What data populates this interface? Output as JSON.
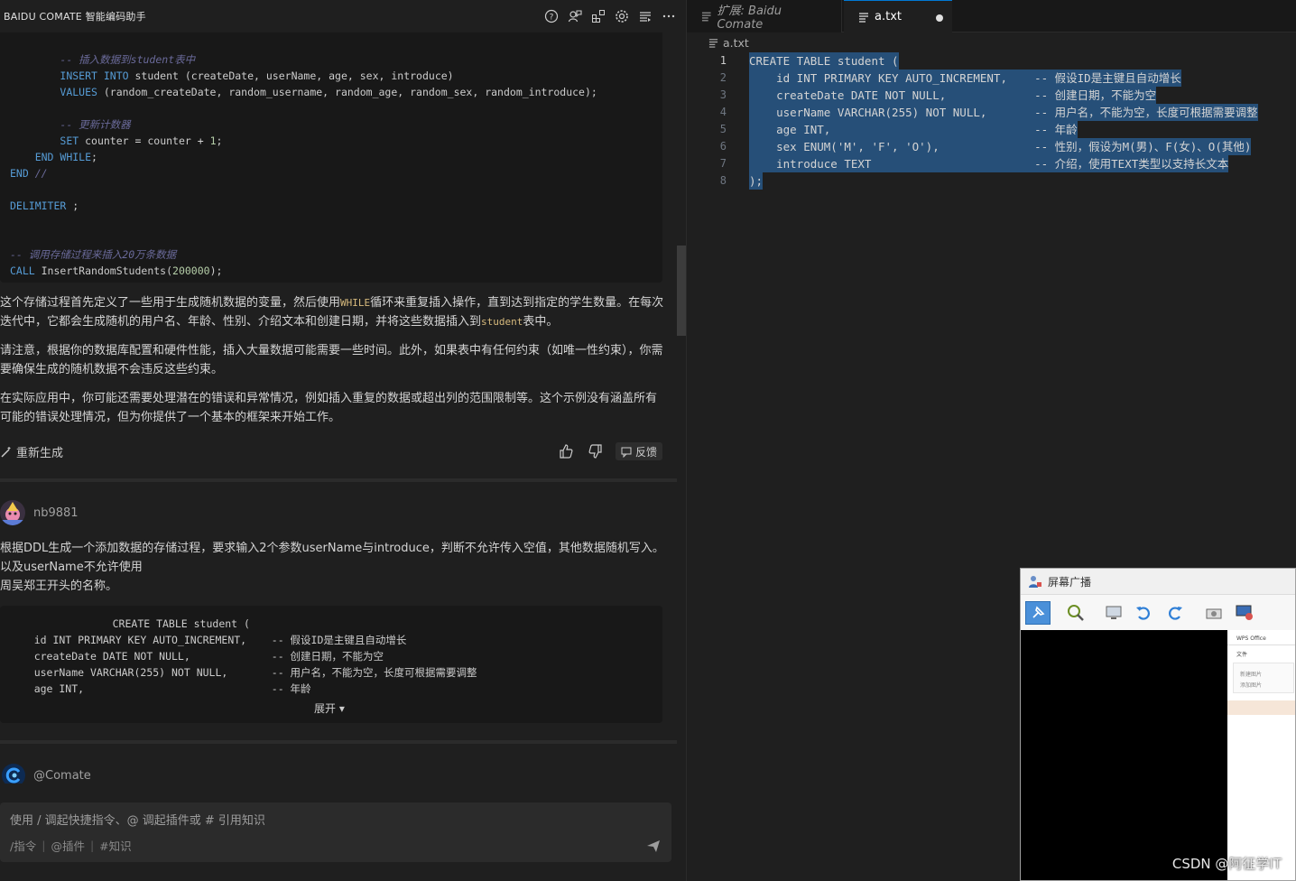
{
  "left_panel": {
    "title": "BAIDU COMATE 智能编码助手",
    "header_icons": [
      "help-icon",
      "user-chat-icon",
      "plugins-icon",
      "settings-icon",
      "list-icon",
      "more-icon"
    ],
    "code_block_1": {
      "lines": [
        {
          "indent": "        ",
          "parts": [
            {
              "t": "-- 插入数据到student表中",
              "c": "cmt2"
            }
          ]
        },
        {
          "indent": "        ",
          "parts": [
            {
              "t": "INSERT INTO",
              "c": "kw"
            },
            {
              "t": " student (createDate, userName, age, sex, introduce)",
              "c": ""
            }
          ]
        },
        {
          "indent": "        ",
          "parts": [
            {
              "t": "VALUES",
              "c": "kw"
            },
            {
              "t": " (random_createDate, random_username, random_age, random_sex, random_introduce);",
              "c": ""
            }
          ]
        },
        {
          "indent": "",
          "parts": []
        },
        {
          "indent": "        ",
          "parts": [
            {
              "t": "-- 更新计数器",
              "c": "cmt2"
            }
          ]
        },
        {
          "indent": "        ",
          "parts": [
            {
              "t": "SET",
              "c": "kw"
            },
            {
              "t": " counter ",
              "c": ""
            },
            {
              "t": "=",
              "c": "op"
            },
            {
              "t": " counter ",
              "c": ""
            },
            {
              "t": "+",
              "c": "op"
            },
            {
              "t": " ",
              "c": ""
            },
            {
              "t": "1",
              "c": "num"
            },
            {
              "t": ";",
              "c": ""
            }
          ]
        },
        {
          "indent": "    ",
          "parts": [
            {
              "t": "END WHILE",
              "c": "kw"
            },
            {
              "t": ";",
              "c": ""
            }
          ]
        },
        {
          "indent": "",
          "parts": [
            {
              "t": "END",
              "c": "kw"
            },
            {
              "t": " //",
              "c": "cmt2"
            }
          ]
        },
        {
          "indent": "",
          "parts": []
        },
        {
          "indent": "",
          "parts": [
            {
              "t": "DELIMITER",
              "c": "kw"
            },
            {
              "t": " ;",
              "c": ""
            }
          ]
        },
        {
          "indent": "",
          "parts": []
        },
        {
          "indent": "",
          "parts": []
        },
        {
          "indent": "",
          "parts": [
            {
              "t": "-- 调用存储过程来插入20万条数据",
              "c": "cmt2"
            }
          ]
        },
        {
          "indent": "",
          "parts": [
            {
              "t": "CALL",
              "c": "kw"
            },
            {
              "t": " InsertRandomStudents(",
              "c": ""
            },
            {
              "t": "200000",
              "c": "num"
            },
            {
              "t": ");",
              "c": ""
            }
          ]
        }
      ]
    },
    "paragraph_1": {
      "before": "这个存储过程首先定义了一些用于生成随机数据的变量，然后使用",
      "code1": "WHILE",
      "middle": "循环来重复插入操作，直到达到指定的学生数量。在每次迭代中，它都会生成随机的用户名、年龄、性别、介绍文本和创建日期，并将这些数据插入到",
      "code2": "student",
      "after": "表中。"
    },
    "paragraph_2": "请注意，根据你的数据库配置和硬件性能，插入大量数据可能需要一些时间。此外，如果表中有任何约束（如唯一性约束），你需要确保生成的随机数据不会违反这些约束。",
    "paragraph_3": "在实际应用中，你可能还需要处理潜在的错误和异常情况，例如插入重复的数据或超出列的范围限制等。这个示例没有涵盖所有可能的错误处理情况，但为你提供了一个基本的框架来开始工作。",
    "actions": {
      "regenerate": "重新生成",
      "feedback": "反馈"
    },
    "user": {
      "name": "nb9881",
      "message_line1": "根据DDL生成一个添加数据的存储过程，要求输入2个参数userName与introduce，判断不允许传入空值，其他数据随机写入。以及userName不允许使用",
      "message_line2": "周吴郑王开头的名称。"
    },
    "code_block_2": {
      "lines": [
        "                  CREATE TABLE student (",
        "    id INT PRIMARY KEY AUTO_INCREMENT,    -- 假设ID是主键且自动增长",
        "    createDate DATE NOT NULL,             -- 创建日期，不能为空",
        "    userName VARCHAR(255) NOT NULL,       -- 用户名，不能为空，长度可根据需要调整",
        "    age INT,                              -- 年龄"
      ],
      "expand": "展开 ▾"
    },
    "assistant": {
      "name": "@Comate"
    },
    "input": {
      "placeholder": "使用 / 调起快捷指令、@ 调起插件或 # 引用知识",
      "chip_command": "/指令",
      "chip_plugin": "@插件",
      "chip_knowledge": "#知识"
    }
  },
  "editor": {
    "tabs": [
      {
        "label": "扩展: Baidu Comate",
        "active": false
      },
      {
        "label": "a.txt",
        "active": true,
        "dirty": true
      }
    ],
    "breadcrumb": "a.txt",
    "lines": [
      {
        "n": "1",
        "text": "CREATE TABLE student ("
      },
      {
        "n": "2",
        "text": "    id INT PRIMARY KEY AUTO_INCREMENT,    -- 假设ID是主键且自动增长"
      },
      {
        "n": "3",
        "text": "    createDate DATE NOT NULL,             -- 创建日期，不能为空"
      },
      {
        "n": "4",
        "text": "    userName VARCHAR(255) NOT NULL,       -- 用户名，不能为空，长度可根据需要调整"
      },
      {
        "n": "5",
        "text": "    age INT,                              -- 年龄"
      },
      {
        "n": "6",
        "text": "    sex ENUM('M', 'F', 'O'),              -- 性别，假设为M(男)、F(女)、O(其他)"
      },
      {
        "n": "7",
        "text": "    introduce TEXT                        -- 介绍，使用TEXT类型以支持长文本"
      },
      {
        "n": "8",
        "text": ");"
      }
    ]
  },
  "broadcast": {
    "title": "屏幕广播",
    "side_app": "WPS Office",
    "side_menu": "文件",
    "side_item1": "新建图片",
    "side_item2": "添加图片"
  },
  "watermark": "CSDN @阿征学IT"
}
